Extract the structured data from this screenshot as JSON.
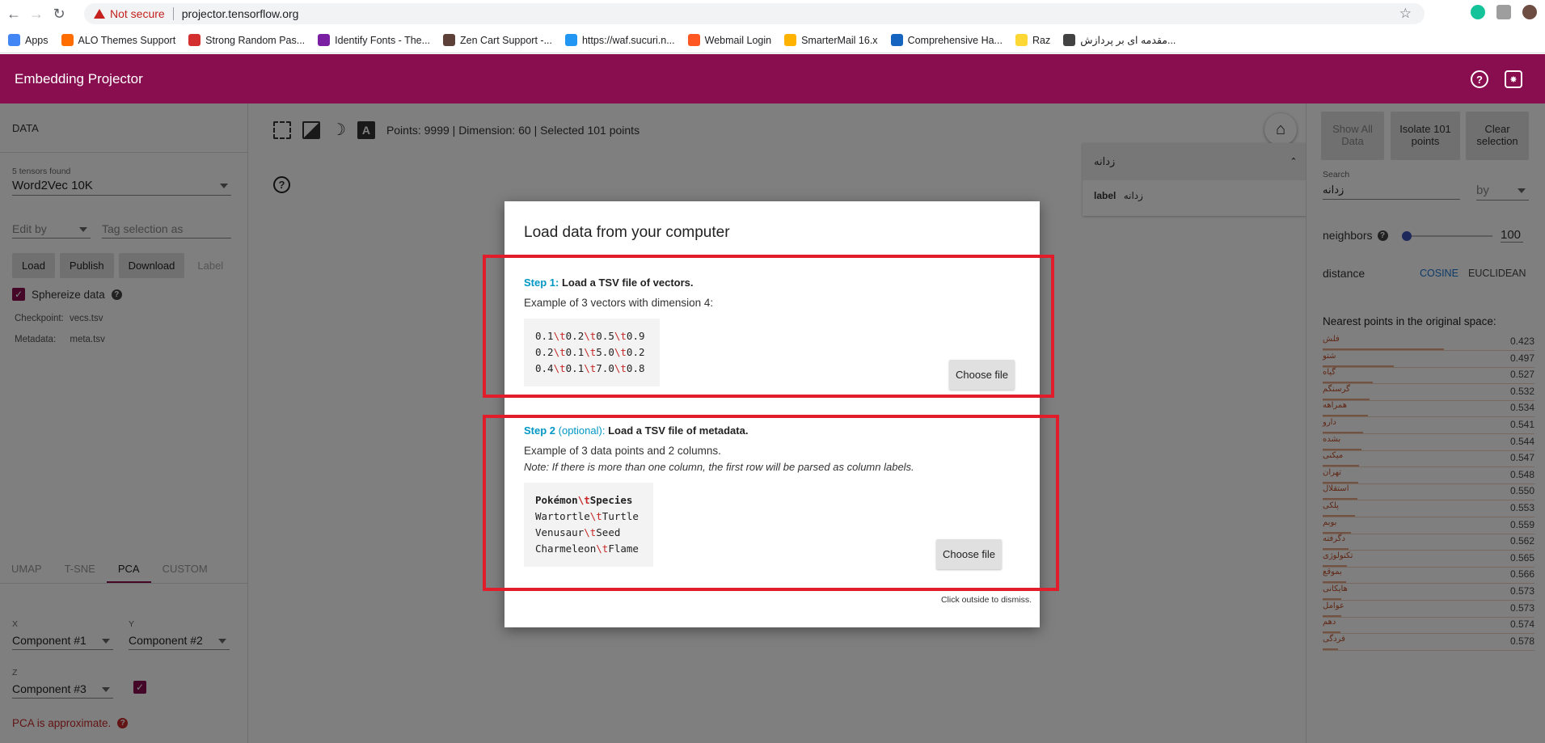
{
  "browser": {
    "security": "Not secure",
    "url": "projector.tensorflow.org",
    "bookmarks": [
      {
        "label": "Apps",
        "color": "#4285f4"
      },
      {
        "label": "ALO Themes Support",
        "color": "#ff6d00"
      },
      {
        "label": "Strong Random Pas...",
        "color": "#d32f2f"
      },
      {
        "label": "Identify Fonts - The...",
        "color": "#7b1fa2"
      },
      {
        "label": "Zen Cart Support -...",
        "color": "#5d4037"
      },
      {
        "label": "https://waf.sucuri.n...",
        "color": "#2196f3"
      },
      {
        "label": "Webmail Login",
        "color": "#ff5722"
      },
      {
        "label": "SmarterMail 16.x",
        "color": "#ffb300"
      },
      {
        "label": "Comprehensive Ha...",
        "color": "#1565c0"
      },
      {
        "label": "Raz",
        "color": "#fdd835"
      },
      {
        "label": "مقدمه ای بر پردازش...",
        "color": "#424242"
      }
    ]
  },
  "app": {
    "title": "Embedding Projector",
    "accent": "#880e4f"
  },
  "left": {
    "section": "DATA",
    "tensors_found": "5 tensors found",
    "tensor": "Word2Vec 10K",
    "edit_by": "Edit by",
    "tag_placeholder": "Tag selection as",
    "buttons": {
      "load": "Load",
      "publish": "Publish",
      "download": "Download",
      "label": "Label"
    },
    "sphereize": "Sphereize data",
    "checkpoint_label": "Checkpoint:",
    "checkpoint_value": "vecs.tsv",
    "metadata_label": "Metadata:",
    "metadata_value": "meta.tsv",
    "tabs": [
      "UMAP",
      "T-SNE",
      "PCA",
      "CUSTOM"
    ],
    "active_tab": "PCA",
    "x_label": "X",
    "x_value": "Component #1",
    "y_label": "Y",
    "y_value": "Component #2",
    "z_label": "Z",
    "z_value": "Component #3",
    "pca_note": "PCA is approximate."
  },
  "center": {
    "stats": "Points: 9999 | Dimension: 60 | Selected 101 points",
    "search_query": "زدانه",
    "label_key": "label",
    "label_value": "زدانه"
  },
  "right": {
    "show_all": "Show All Data",
    "isolate": "Isolate 101 points",
    "clear": "Clear selection",
    "search_label": "Search",
    "search_value": "زدانه",
    "by": "by",
    "neighbors": "neighbors",
    "neighbors_value": "100",
    "neighbors_level": 0.0,
    "distance": "distance",
    "cosine": "COSINE",
    "euclidean": "EUCLIDEAN",
    "nearest_title": "Nearest points in the original space:",
    "nearest": [
      {
        "word": "فلش",
        "value": "0.423"
      },
      {
        "word": "شتو",
        "value": "0.497"
      },
      {
        "word": "گیاه",
        "value": "0.527"
      },
      {
        "word": "گرسنگم",
        "value": "0.532"
      },
      {
        "word": "همراهه",
        "value": "0.534"
      },
      {
        "word": "دارو",
        "value": "0.541"
      },
      {
        "word": "بشده",
        "value": "0.544"
      },
      {
        "word": "میکنی",
        "value": "0.547"
      },
      {
        "word": "تهران",
        "value": "0.548"
      },
      {
        "word": "استقلال",
        "value": "0.550"
      },
      {
        "word": "پلکی",
        "value": "0.553"
      },
      {
        "word": "بوبم",
        "value": "0.559"
      },
      {
        "word": "دگرفته",
        "value": "0.562"
      },
      {
        "word": "تکنولوژی",
        "value": "0.565"
      },
      {
        "word": "بموقع",
        "value": "0.566"
      },
      {
        "word": "هایکانی",
        "value": "0.573"
      },
      {
        "word": "عوامل",
        "value": "0.573"
      },
      {
        "word": "دهم",
        "value": "0.574"
      },
      {
        "word": "فردگی",
        "value": "0.578"
      }
    ]
  },
  "modal": {
    "title": "Load data from your computer",
    "step1_label": "Step 1:",
    "step1_title": "Load a TSV file of vectors.",
    "step1_desc": "Example of 3 vectors with dimension 4:",
    "step1_rows": [
      [
        "0.1",
        "0.2",
        "0.5",
        "0.9"
      ],
      [
        "0.2",
        "0.1",
        "5.0",
        "0.2"
      ],
      [
        "0.4",
        "0.1",
        "7.0",
        "0.8"
      ]
    ],
    "choose_file": "Choose file",
    "step2_label": "Step 2",
    "step2_optional": "(optional):",
    "step2_title": "Load a TSV file of metadata.",
    "step2_desc": "Example of 3 data points and 2 columns.",
    "step2_note": "Note: If there is more than one column, the first row will be parsed as column labels.",
    "step2_rows": [
      [
        "Pokémon",
        "Species"
      ],
      [
        "Wartortle",
        "Turtle"
      ],
      [
        "Venusaur",
        "Seed"
      ],
      [
        "Charmeleon",
        "Flame"
      ]
    ],
    "dismiss": "Click outside to dismiss.",
    "tab_escape": "\\t"
  }
}
